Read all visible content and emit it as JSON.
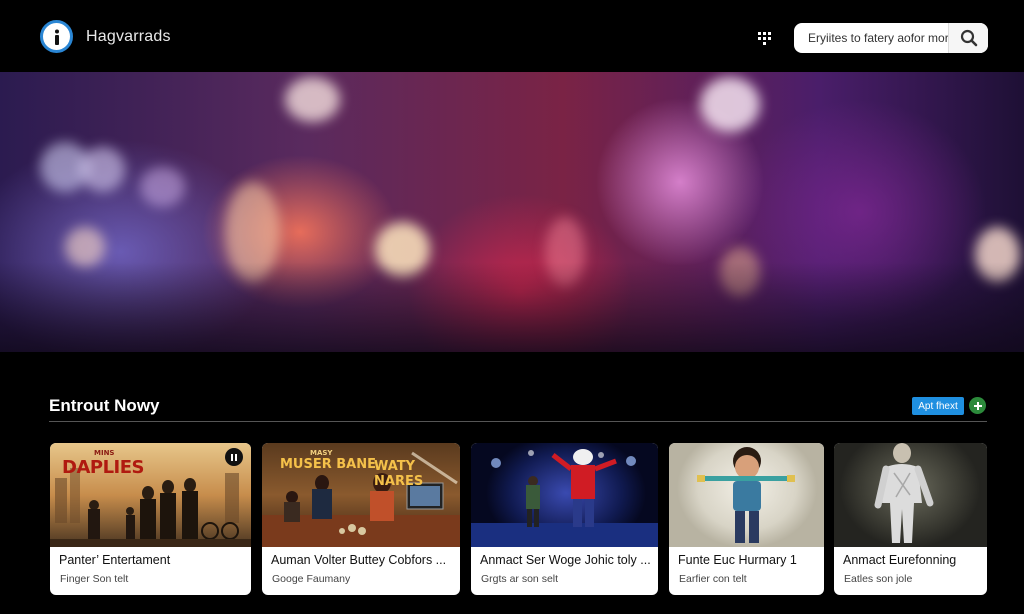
{
  "header": {
    "brand": "Hagvarrads",
    "search_placeholder": "Eryiites to fatery aofor more",
    "logo_icon": "info-icon",
    "apps_icon": "grid-icon",
    "search_icon": "search-icon"
  },
  "section": {
    "title": "Entrout Nowy",
    "button_label": "Apt fhext",
    "add_icon": "plus-icon"
  },
  "cards": [
    {
      "title": "Panter’ Entertament",
      "subtitle": "Finger Son telt",
      "thumb_text": "DAPLIES",
      "thumb_small": "MINS"
    },
    {
      "title": "Auman Volter Buttey Cobfors ...",
      "subtitle": "Googe Faumany",
      "thumb_text": "MUSER BANE",
      "thumb_text2": "WATY NARES",
      "thumb_small": "MASY"
    },
    {
      "title": "Anmact Ser Woge Johic toly ...",
      "subtitle": "Grgts ar son selt"
    },
    {
      "title": "Funte Euc Hurmary 1",
      "subtitle": "Earfier con telt"
    },
    {
      "title": "Anmact Eurefonning",
      "subtitle": "Eatles son jole"
    }
  ],
  "colors": {
    "accent": "#1f8fe0",
    "add": "#2c8a3b",
    "logo_ring": "#2a86d4"
  }
}
